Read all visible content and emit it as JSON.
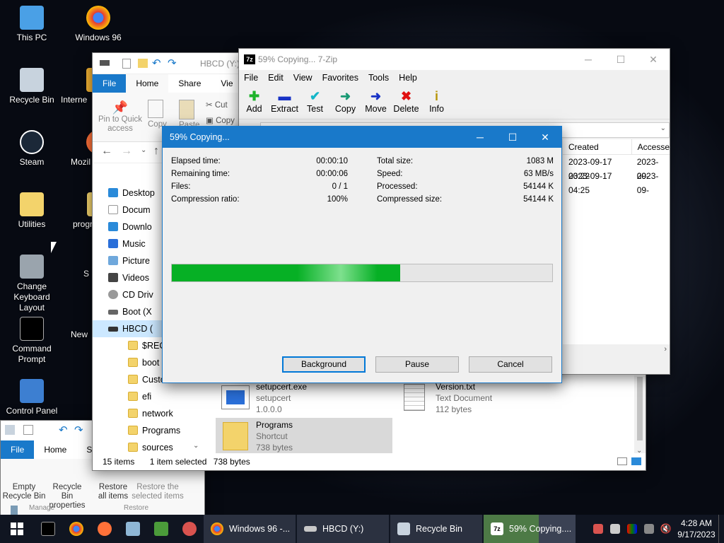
{
  "desktop": {
    "icons": [
      {
        "label": "This PC",
        "color": "#4aa0e6"
      },
      {
        "label": "Windows 96",
        "color": "#e53935"
      },
      {
        "label": "Recycle Bin",
        "color": "#c8d3de"
      },
      {
        "label": "Interne",
        "color": "#f2b233"
      },
      {
        "label": "Steam",
        "color": "#1b2838"
      },
      {
        "label": "Mozil",
        "color": "#ff7139"
      },
      {
        "label": "Utilities",
        "color": "#f3d36b"
      },
      {
        "label": "progr",
        "color": "#f3d36b"
      },
      {
        "label": "Change Keyboard Layout",
        "color": "#9aa4ad"
      },
      {
        "label": "S",
        "color": "#3b7dd8"
      },
      {
        "label": "Command Prompt",
        "color": "#000000"
      },
      {
        "label": "New",
        "color": "#f3d36b"
      },
      {
        "label": "Control Panel",
        "color": "#3d7fd1"
      }
    ]
  },
  "explorer": {
    "title": "HBCD (Y:)",
    "tabs": [
      "File",
      "Home",
      "Share",
      "Vie"
    ],
    "ribbon": {
      "pin": "Pin to Quick access",
      "copy": "Copy",
      "paste": "Paste",
      "cut": "Cut",
      "copy2": "Copy"
    },
    "tree": [
      "Desktop",
      "Docum",
      "Downlo",
      "Music",
      "Picture",
      "Videos",
      "CD Driv",
      "Boot (X",
      "HBCD ("
    ],
    "folders": [
      "$RECY",
      "boot",
      "Custom",
      "efi",
      "network",
      "Programs",
      "sources"
    ],
    "files": [
      {
        "name": "setupcert.exe",
        "line2": "setupcert",
        "line3": "1.0.0.0"
      },
      {
        "name": "Version.txt",
        "line2": "Text Document",
        "line3": "112 bytes"
      },
      {
        "name": "Programs",
        "line2": "Shortcut",
        "line3": "738 bytes"
      }
    ],
    "status": {
      "items": "15 items",
      "selected": "1 item selected",
      "size": "738 bytes"
    }
  },
  "recycle": {
    "tabs": [
      "File",
      "Home",
      "S"
    ],
    "actions": [
      "Empty Recycle Bin",
      "Recycle Bin properties",
      "Restore all items",
      "Restore the selected items"
    ],
    "group_labels": [
      "Manage",
      "Restore"
    ]
  },
  "zip": {
    "title": "59% Copying... 7-Zip",
    "menu": [
      "File",
      "Edit",
      "View",
      "Favorites",
      "Tools",
      "Help"
    ],
    "toolbar": [
      {
        "label": "Add",
        "glyph": "✚",
        "color": "#1db32a"
      },
      {
        "label": "Extract",
        "glyph": "▬",
        "color": "#1833c6"
      },
      {
        "label": "Test",
        "glyph": "✔",
        "color": "#14b6c8"
      },
      {
        "label": "Copy",
        "glyph": "➜",
        "color": "#1a9a74"
      },
      {
        "label": "Move",
        "glyph": "➜",
        "color": "#1833c6"
      },
      {
        "label": "Delete",
        "glyph": "✖",
        "color": "#e01010"
      },
      {
        "label": "Info",
        "glyph": "i",
        "color": "#b8960a"
      }
    ],
    "columns": [
      "Created",
      "Accesse"
    ],
    "rows": [
      [
        "2023-09-17 03:22",
        "2023-09-"
      ],
      [
        "2023-09-17 04:25",
        "2023-09-"
      ]
    ]
  },
  "dialog": {
    "title": "59% Copying...",
    "stats_left": [
      {
        "label": "Elapsed time:",
        "value": "00:00:10"
      },
      {
        "label": "Remaining time:",
        "value": "00:00:06"
      },
      {
        "label": "Files:",
        "value": "0 / 1"
      },
      {
        "label": "Compression ratio:",
        "value": "100%"
      }
    ],
    "stats_right": [
      {
        "label": "Total size:",
        "value": "1083 M"
      },
      {
        "label": "Speed:",
        "value": "63 MB/s"
      },
      {
        "label": "Processed:",
        "value": "54144 K"
      },
      {
        "label": "Compressed size:",
        "value": "54144 K"
      }
    ],
    "progress": 0.6,
    "buttons": {
      "background": "Background",
      "pause": "Pause",
      "cancel": "Cancel"
    }
  },
  "taskbar": {
    "apps": [
      {
        "label": "Windows 96 -...",
        "color": "#e53935"
      },
      {
        "label": "HBCD (Y:)",
        "color": "#c8c8c8"
      },
      {
        "label": "Recycle Bin",
        "color": "#c8d3de"
      },
      {
        "label": "59% Copying....",
        "color": "#ffffff"
      }
    ],
    "time": "4:28 AM",
    "date": "9/17/2023"
  }
}
